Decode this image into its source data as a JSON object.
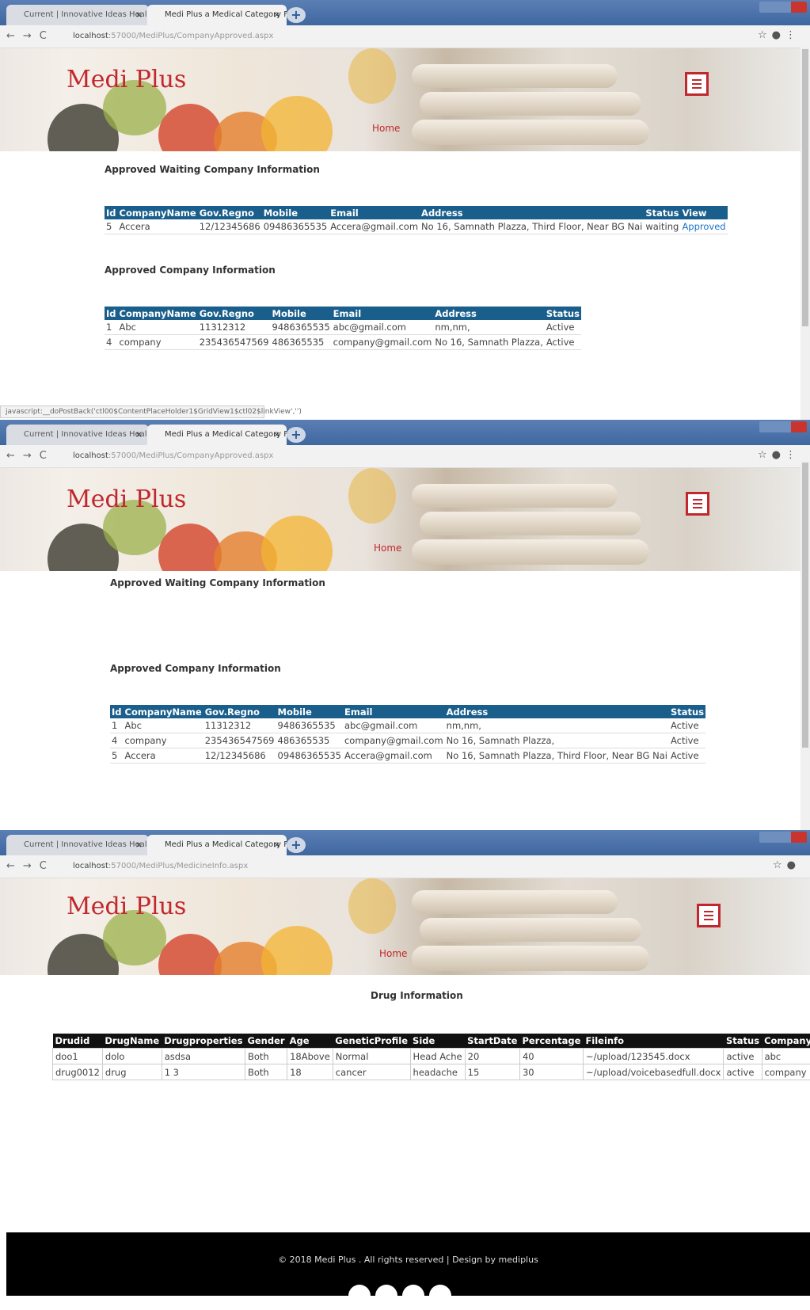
{
  "brand": "Medi Plus",
  "nav_home": "Home",
  "screens": [
    {
      "tabs": [
        "Current | Innovative Ideas Health",
        "Medi Plus a Medical Category Fr..."
      ],
      "url_host": "localhost",
      "url_path": ":57000/MediPlus/CompanyApproved.aspx",
      "status_text": "javascript:__doPostBack('ctl00$ContentPlaceHolder1$GridView1$ctl02$linkView','')"
    },
    {
      "tabs": [
        "Current | Innovative Ideas Health",
        "Medi Plus a Medical Category Fr..."
      ],
      "url_host": "localhost",
      "url_path": ":57000/MediPlus/CompanyApproved.aspx"
    },
    {
      "tabs": [
        "Current | Innovative Ideas Health",
        "Medi Plus a Medical Category Fr..."
      ],
      "url_host": "localhost",
      "url_path": ":57000/MediPlus/MedicineInfo.aspx"
    }
  ],
  "waiting_title": "Approved Waiting Company Information",
  "approved_title": "Approved Company Information",
  "waiting_table": {
    "headers": [
      "Id",
      "CompanyName",
      "Gov.Regno",
      "Mobile",
      "Email",
      "Address",
      "Status",
      "View"
    ],
    "rows": [
      [
        "5",
        "Accera",
        "12/12345686",
        "09486365535",
        "Accera@gmail.com",
        "No 16, Samnath Plazza, Third Floor, Near BG Nai",
        "waiting",
        "Approved"
      ]
    ]
  },
  "approved_table_1": {
    "headers": [
      "Id",
      "CompanyName",
      "Gov.Regno",
      "Mobile",
      "Email",
      "Address",
      "Status"
    ],
    "rows": [
      [
        "1",
        "Abc",
        "11312312",
        "9486365535",
        "abc@gmail.com",
        "nm,nm,",
        "Active"
      ],
      [
        "4",
        "company",
        "235436547569",
        "486365535",
        "company@gmail.com",
        "No 16, Samnath Plazza,",
        "Active"
      ]
    ]
  },
  "approved_table_2": {
    "headers": [
      "Id",
      "CompanyName",
      "Gov.Regno",
      "Mobile",
      "Email",
      "Address",
      "Status"
    ],
    "rows": [
      [
        "1",
        "Abc",
        "11312312",
        "9486365535",
        "abc@gmail.com",
        "nm,nm,",
        "Active"
      ],
      [
        "4",
        "company",
        "235436547569",
        "486365535",
        "company@gmail.com",
        "No 16, Samnath Plazza,",
        "Active"
      ],
      [
        "5",
        "Accera",
        "12/12345686",
        "09486365535",
        "Accera@gmail.com",
        "No 16, Samnath Plazza, Third Floor, Near BG Nai",
        "Active"
      ]
    ]
  },
  "drug_title": "Drug Information",
  "drug_table": {
    "headers": [
      "Drudid",
      "DrugName",
      "Drugproperties",
      "Gender",
      "Age",
      "GeneticProfile",
      "Side",
      "StartDate",
      "Percentage",
      "Fileinfo",
      "Status",
      "Company"
    ],
    "rows": [
      [
        "doo1",
        "dolo",
        "asdsa",
        "Both",
        "18Above",
        "Normal",
        "Head Ache",
        "20",
        "40",
        "~/upload/123545.docx",
        "active",
        "abc"
      ],
      [
        "drug0012",
        "drug",
        "1 3",
        "Both",
        "18",
        "cancer",
        "headache",
        "15",
        "30",
        "~/upload/voicebasedfull.docx",
        "active",
        "company"
      ]
    ]
  },
  "footer_text": "© 2018 Medi Plus . All rights reserved | Design by mediplus",
  "colors": {
    "brand_red": "#c1272d",
    "table_header_blue": "#1a5f8c",
    "table_header_black": "#111111",
    "footer_bg": "#000000"
  }
}
